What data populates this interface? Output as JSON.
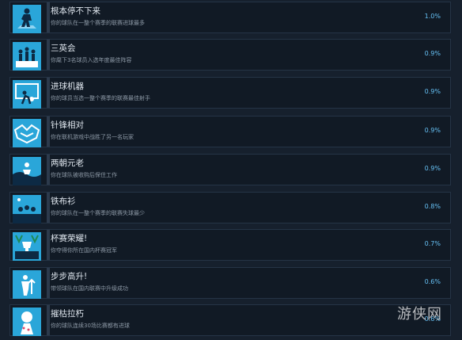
{
  "achievements": [
    {
      "title": "根本停不下来",
      "description": "你的球队在一整个赛季的联赛进球最多",
      "percent": "1.0%",
      "icon": "player-icon"
    },
    {
      "title": "三英会",
      "description": "你麾下3名球员入选年度最佳阵容",
      "percent": "0.9%",
      "icon": "podium-icon"
    },
    {
      "title": "进球机器",
      "description": "你的球员当选一整个赛季的联赛最佳射手",
      "percent": "0.9%",
      "icon": "goal-icon"
    },
    {
      "title": "针锋相对",
      "description": "你在联机游戏中战胜了另一名玩家",
      "percent": "0.9%",
      "icon": "handshake-icon"
    },
    {
      "title": "两朝元老",
      "description": "你在球队被收购后保住工作",
      "percent": "0.9%",
      "icon": "veteran-icon"
    },
    {
      "title": "铁布衫",
      "description": "你的球队在一整个赛季的联赛失球最少",
      "percent": "0.8%",
      "icon": "wall-icon"
    },
    {
      "title": "杯赛荣耀!",
      "description": "你夺得你所在国内杯赛冠军",
      "percent": "0.7%",
      "icon": "cup-icon"
    },
    {
      "title": "步步高升!",
      "description": "带领球队在国内联赛中升级成功",
      "percent": "0.6%",
      "icon": "promotion-icon"
    },
    {
      "title": "摧枯拉朽",
      "description": "你的球队连续30场比赛都有进球",
      "percent": "0.6%",
      "icon": "pawn-icon"
    }
  ]
}
